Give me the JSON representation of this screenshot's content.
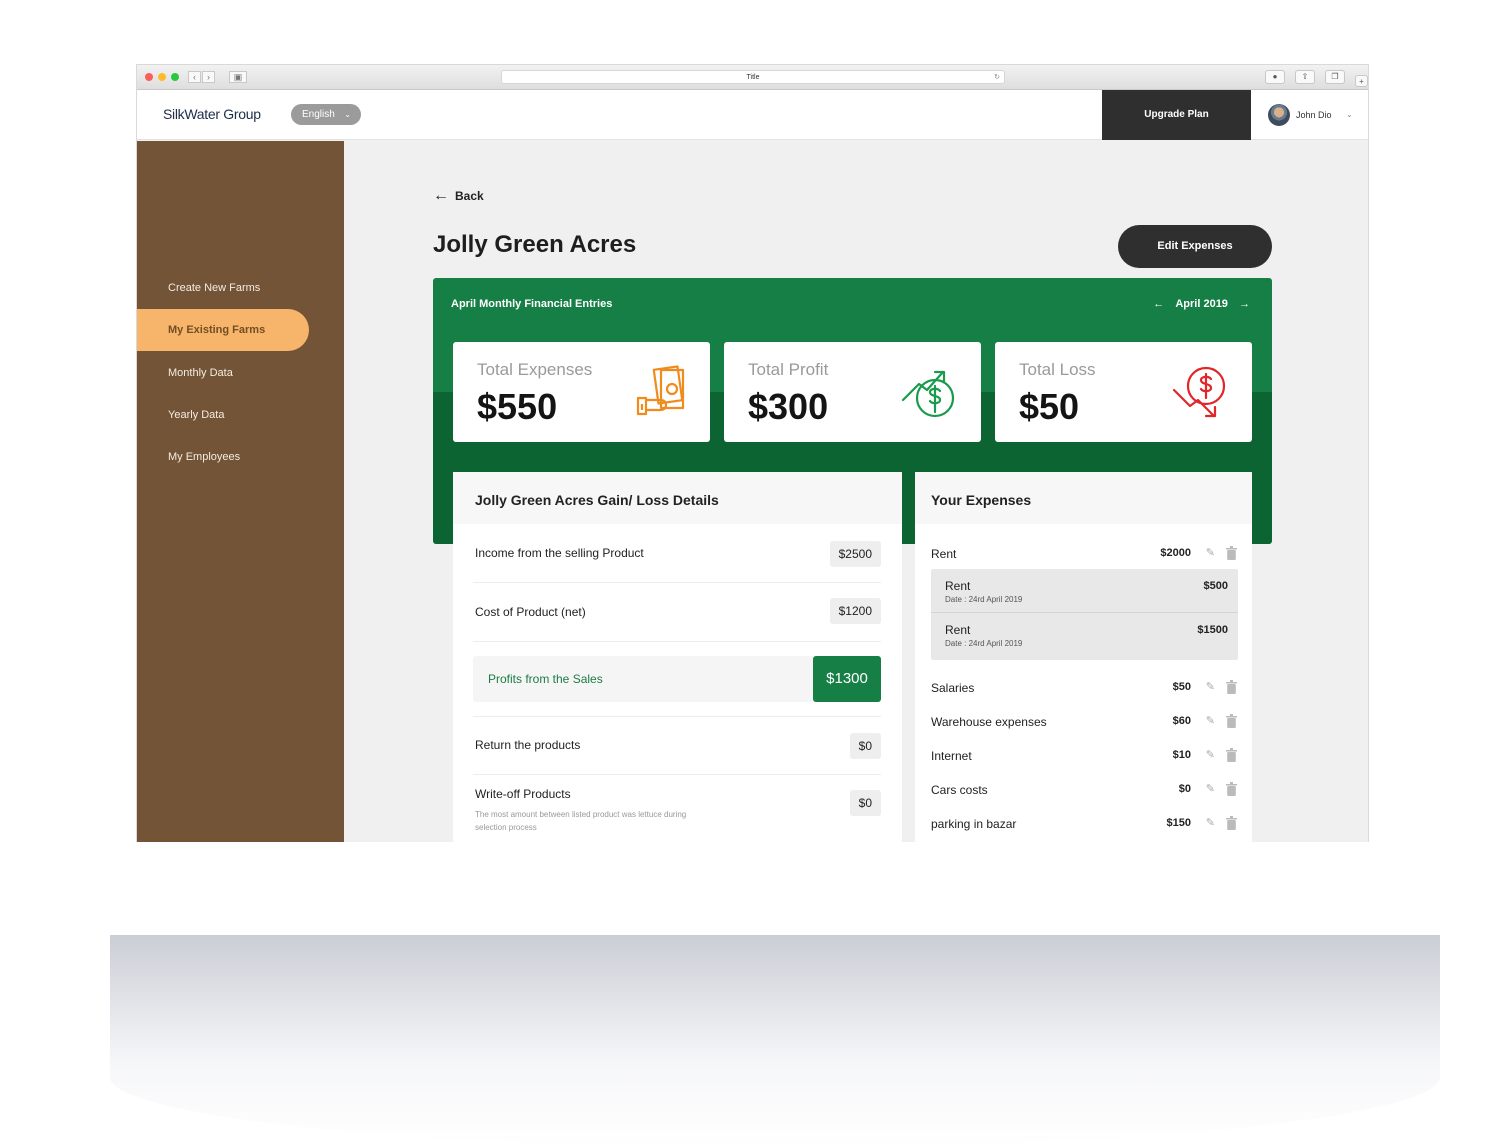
{
  "browser": {
    "title": "Title"
  },
  "header": {
    "logo": "SilkWater Group",
    "language": "English",
    "upgrade_label": "Upgrade Plan",
    "user_name": "John Dio"
  },
  "sidebar": {
    "items": [
      {
        "label": "Create New Farms",
        "active": false
      },
      {
        "label": "My Existing Farms",
        "active": true
      },
      {
        "label": "Monthly Data",
        "active": false
      },
      {
        "label": "Yearly Data",
        "active": false
      },
      {
        "label": "My Employees",
        "active": false
      }
    ]
  },
  "page": {
    "back_label": "Back",
    "title": "Jolly Green Acres",
    "edit_label": "Edit Expenses"
  },
  "panel": {
    "title": "April Monthly Financial Entries",
    "month": "April 2019",
    "stats": [
      {
        "label": "Total Expenses",
        "value": "$550",
        "icon": "cash-hand-icon",
        "color": "#f08c1e"
      },
      {
        "label": "Total Profit",
        "value": "$300",
        "icon": "dollar-growth-icon",
        "color": "#1a9a4c"
      },
      {
        "label": "Total Loss",
        "value": "$50",
        "icon": "dollar-decline-icon",
        "color": "#e0262a"
      }
    ]
  },
  "gain_loss": {
    "title": "Jolly Green Acres Gain/ Loss Details",
    "rows": [
      {
        "label": "Income from the selling Product",
        "value": "$2500"
      },
      {
        "label": "Cost of Product (net)",
        "value": "$1200"
      },
      {
        "label": "Return the products",
        "value": "$0"
      },
      {
        "label": "Write-off Products",
        "value": "$0",
        "note": "The most amount between listed product was  lettuce during selection process"
      }
    ],
    "profit": {
      "label": "Profits from the Sales",
      "value": "$1300"
    }
  },
  "expenses": {
    "title": "Your Expenses",
    "rent": {
      "label": "Rent",
      "value": "$2000"
    },
    "rent_items": [
      {
        "label": "Rent",
        "date": "Date : 24rd April 2019",
        "value": "$500"
      },
      {
        "label": "Rent",
        "date": "Date : 24rd April 2019",
        "value": "$1500"
      }
    ],
    "items": [
      {
        "label": "Salaries",
        "value": "$50"
      },
      {
        "label": "Warehouse expenses",
        "value": "$60"
      },
      {
        "label": "Internet",
        "value": "$10"
      },
      {
        "label": "Cars costs",
        "value": "$0"
      },
      {
        "label": "parking in bazar",
        "value": "$150"
      }
    ]
  }
}
